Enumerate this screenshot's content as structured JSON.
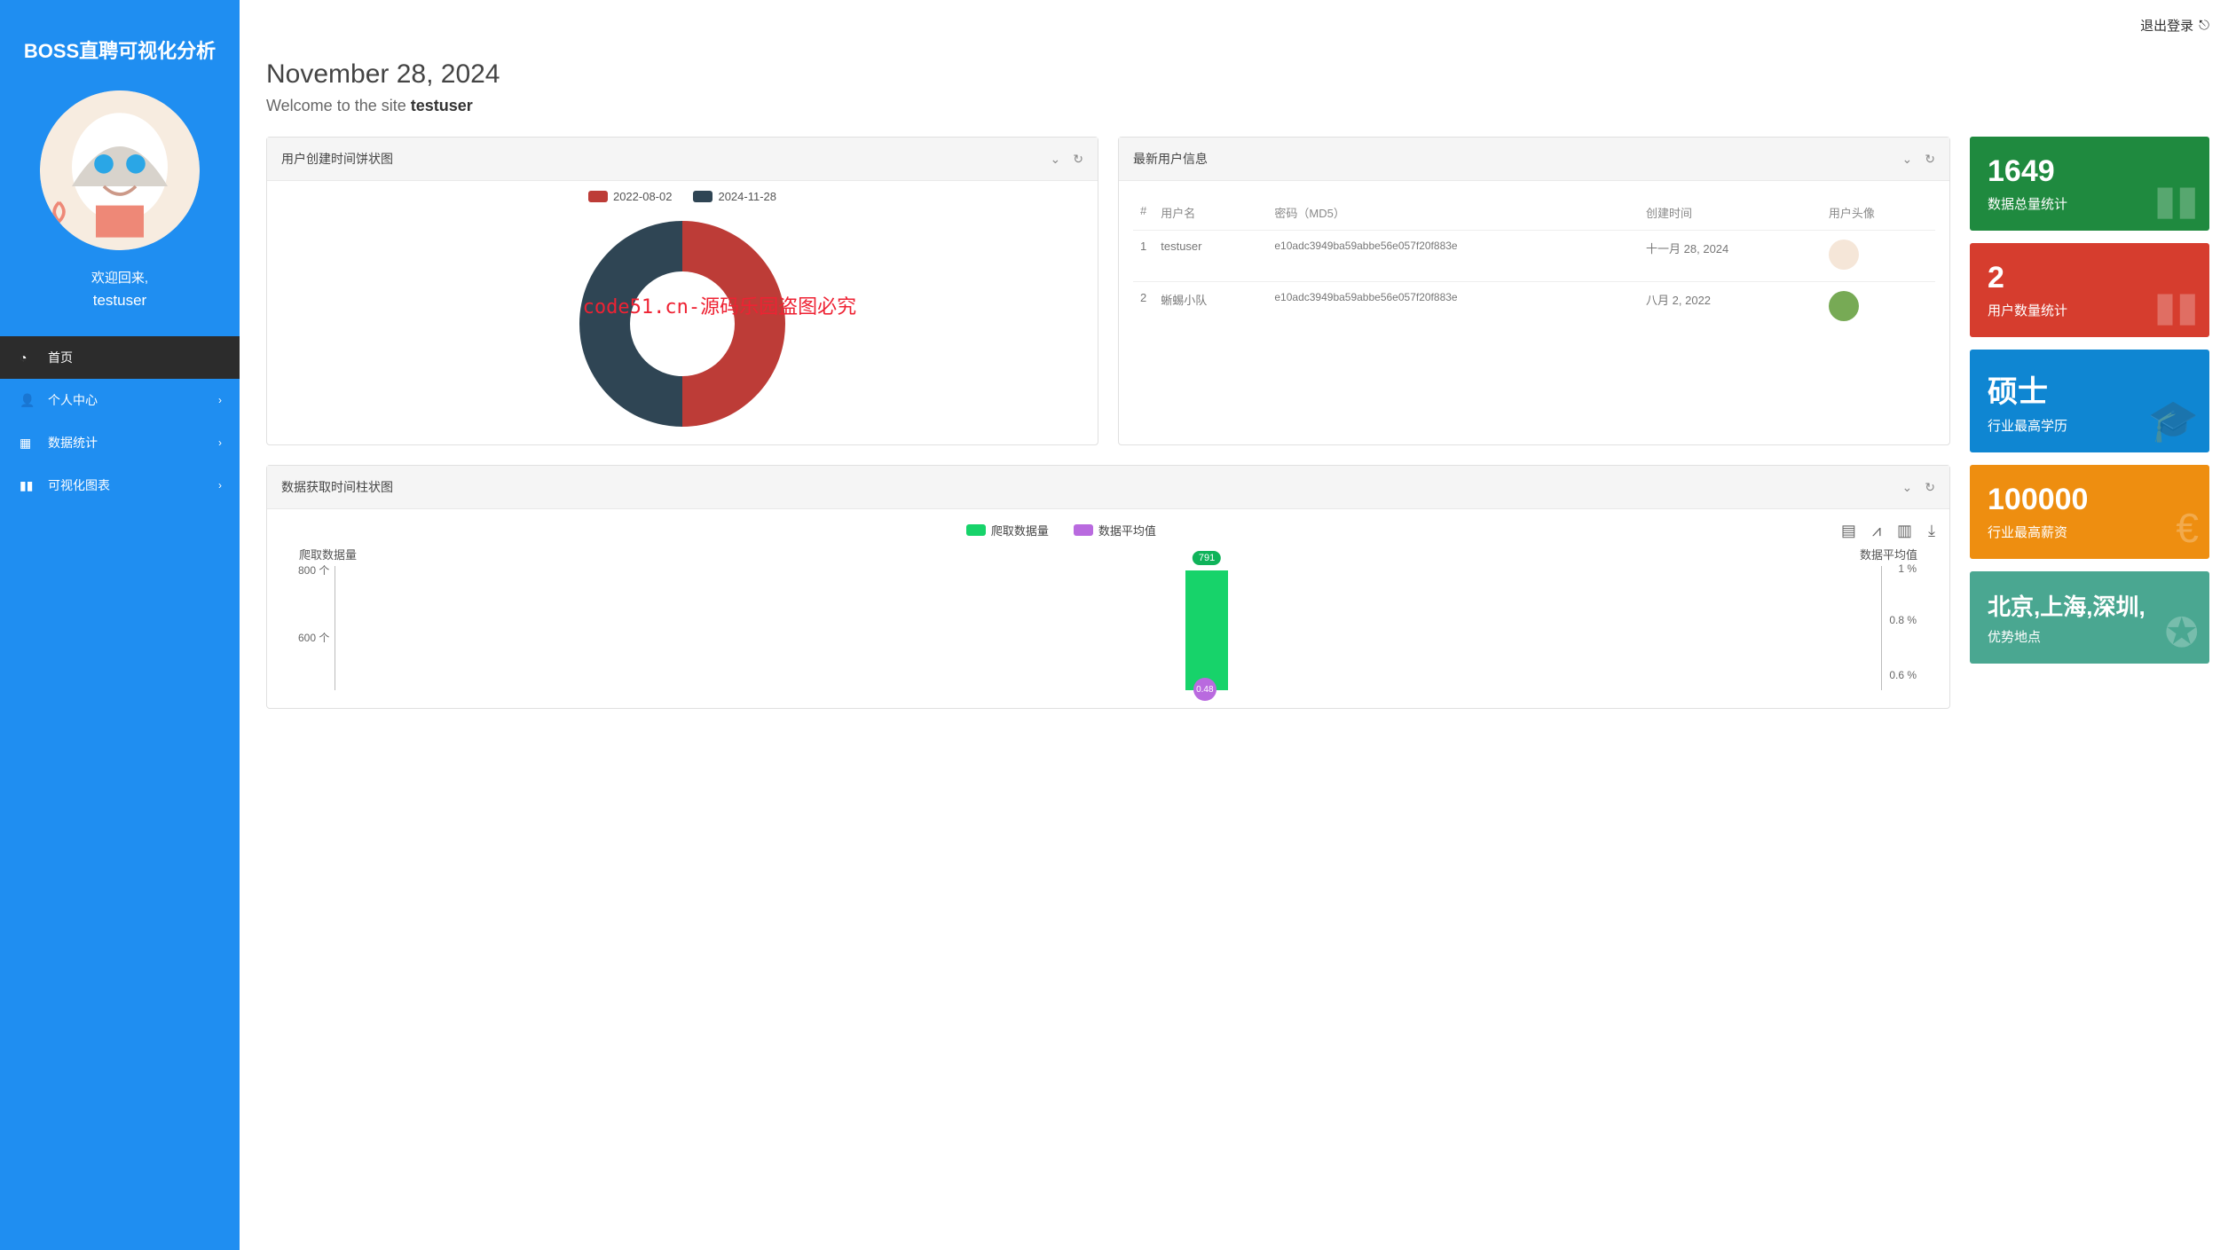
{
  "brand": "BOSS直聘可视化分析",
  "profile": {
    "welcome": "欢迎回来,",
    "username": "testuser"
  },
  "nav": {
    "home": "首页",
    "personal": "个人中心",
    "stats": "数据统计",
    "charts": "可视化图表"
  },
  "logout": "退出登录",
  "header": {
    "date": "November 28, 2024",
    "subtitle_prefix": "Welcome to the site ",
    "subtitle_user": "testuser"
  },
  "donut_card": {
    "title": "用户创建时间饼状图"
  },
  "users_card": {
    "title": "最新用户信息",
    "cols": {
      "idx": "#",
      "user": "用户名",
      "pwd": "密码（MD5）",
      "time": "创建时间",
      "avatar": "用户头像"
    },
    "rows": [
      {
        "idx": "1",
        "user": "testuser",
        "pwd": "e10adc3949ba59abbe56e057f20f883e",
        "time": "十一月 28, 2024"
      },
      {
        "idx": "2",
        "user": "蜥蜴小队",
        "pwd": "e10adc3949ba59abbe56e057f20f883e",
        "time": "八月 2, 2022"
      }
    ]
  },
  "stats": [
    {
      "value": "1649",
      "label": "数据总量统计",
      "cls": "bg-green",
      "ico": "▮▮"
    },
    {
      "value": "2",
      "label": "用户数量统计",
      "cls": "bg-red",
      "ico": "▮▮"
    },
    {
      "value": "硕士",
      "label": "行业最高学历",
      "cls": "bg-blue",
      "ico": "🎓"
    },
    {
      "value": "100000",
      "label": "行业最高薪资",
      "cls": "bg-orange",
      "ico": "€"
    },
    {
      "value": "北京,上海,深圳,",
      "label": "优势地点",
      "cls": "bg-teal",
      "ico": "✪"
    }
  ],
  "bar_card": {
    "title": "数据获取时间柱状图",
    "legend": {
      "a": "爬取数据量",
      "b": "数据平均值"
    },
    "axis_left": "爬取数据量",
    "axis_right": "数据平均值",
    "yl": {
      "t800": "800 个",
      "t600": "600 个"
    },
    "yr": {
      "p1": "1 %",
      "p08": "0.8 %",
      "p06": "0.6 %"
    },
    "pill": "791",
    "purple": "0.48"
  },
  "watermark": "code51.cn-源码乐园盗图必究",
  "chart_data": [
    {
      "type": "pie",
      "title": "用户创建时间饼状图",
      "categories": [
        "2022-08-02",
        "2024-11-28"
      ],
      "values": [
        1,
        1
      ],
      "colors": [
        "#bd3c37",
        "#2f4554"
      ]
    },
    {
      "type": "bar",
      "title": "数据获取时间柱状图",
      "series": [
        {
          "name": "爬取数据量",
          "values": [
            791
          ],
          "axis": "left",
          "unit": "个",
          "color": "#17d36a"
        },
        {
          "name": "数据平均值",
          "values": [
            0.48
          ],
          "axis": "right",
          "unit": "%",
          "color": "#b96adf"
        }
      ],
      "categories": [
        ""
      ],
      "y_left": {
        "label": "爬取数据量",
        "ticks": [
          600,
          800
        ],
        "unit": "个"
      },
      "y_right": {
        "label": "数据平均值",
        "ticks": [
          0.6,
          0.8,
          1
        ],
        "unit": "%"
      }
    }
  ]
}
